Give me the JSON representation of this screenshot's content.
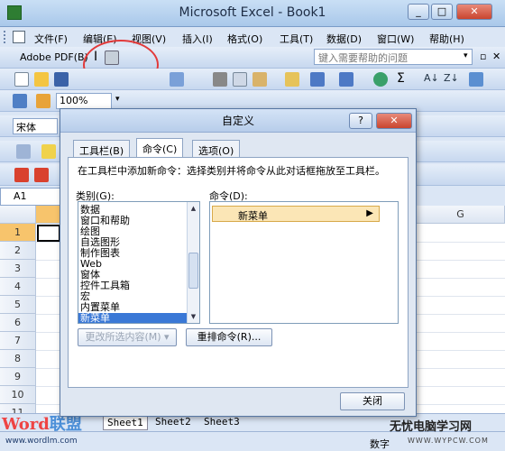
{
  "window": {
    "title": "Microsoft Excel - Book1",
    "min": "_",
    "max": "□",
    "close": "✕"
  },
  "menu": {
    "items": [
      "文件(F)",
      "编辑(E)",
      "视图(V)",
      "插入(I)",
      "格式(O)",
      "工具(T)",
      "数据(D)",
      "窗口(W)",
      "帮助(H)"
    ]
  },
  "adobe_label": "Adobe PDF(B)",
  "help_search": {
    "placeholder": "键入需要帮助的问题"
  },
  "toolbar": {
    "zoom": "100%",
    "font": "宋体"
  },
  "namebox": "A1",
  "sheet": {
    "columns": [
      "G"
    ],
    "rows": [
      "1",
      "2",
      "3",
      "4",
      "5",
      "6",
      "7",
      "8",
      "9",
      "10",
      "11"
    ],
    "tabs": [
      "Sheet1",
      "Sheet2",
      "Sheet3"
    ]
  },
  "status": {
    "mode": "数字"
  },
  "dialog": {
    "title": "自定义",
    "help": "?",
    "tabs": [
      "工具栏(B)",
      "命令(C)",
      "选项(O)"
    ],
    "instruction": "在工具栏中添加新命令：选择类别并将命令从此对话框拖放至工具栏。",
    "categories_label": "类别(G):",
    "commands_label": "命令(D):",
    "categories": [
      "数据",
      "窗口和帮助",
      "绘图",
      "自选图形",
      "制作图表",
      "Web",
      "窗体",
      "控件工具箱",
      "宏",
      "内置菜单",
      "新菜单"
    ],
    "selected_category": "新菜单",
    "command": "新菜单",
    "modify_btn": "更改所选内容(M) ▾",
    "rearrange_btn": "重排命令(R)...",
    "close_btn": "关闭"
  },
  "watermark": {
    "word": "Word",
    "lianmeng": "联盟",
    "url": "www.wordlm.com",
    "right_title": "无忧电脑学习网",
    "right_url": "WWW.WYPCW.COM"
  }
}
